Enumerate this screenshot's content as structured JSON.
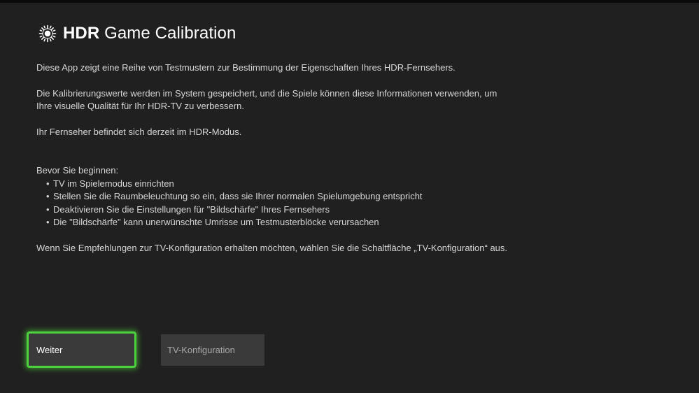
{
  "header": {
    "logo_icon": "hdr-sun-icon",
    "title_bold": "HDR",
    "title_rest": " Game Calibration"
  },
  "content": {
    "paragraph1": "Diese App zeigt eine Reihe von Testmustern zur Bestimmung der Eigenschaften Ihres HDR-Fernsehers.",
    "paragraph2_line1": "Die Kalibrierungswerte werden im System gespeichert, und die Spiele können diese Informationen verwenden, um",
    "paragraph2_line2": "Ihre visuelle Qualität für Ihr HDR-TV zu verbessern.",
    "paragraph3": "Ihr Fernseher befindet sich derzeit im HDR-Modus.",
    "before_heading": "Bevor Sie beginnen:",
    "bullets": [
      "TV im Spielemodus einrichten",
      "Stellen Sie die Raumbeleuchtung so ein, dass sie Ihrer normalen Spielumgebung entspricht",
      "Deaktivieren Sie die Einstellungen für \"Bildschärfe\" Ihres Fernsehers",
      "Die \"Bildschärfe\" kann unerwünschte Umrisse um Testmusterblöcke verursachen"
    ],
    "bullet_glyph": "•",
    "final_paragraph": "Wenn Sie Empfehlungen zur TV-Konfiguration erhalten möchten, wählen Sie die Schaltfläche „TV-Konfiguration“ aus."
  },
  "buttons": {
    "continue_label": "Weiter",
    "tv_config_label": "TV-Konfiguration"
  },
  "colors": {
    "background": "#202020",
    "focus_accent": "#4ed13e",
    "button_bg": "#3a3a3a"
  }
}
